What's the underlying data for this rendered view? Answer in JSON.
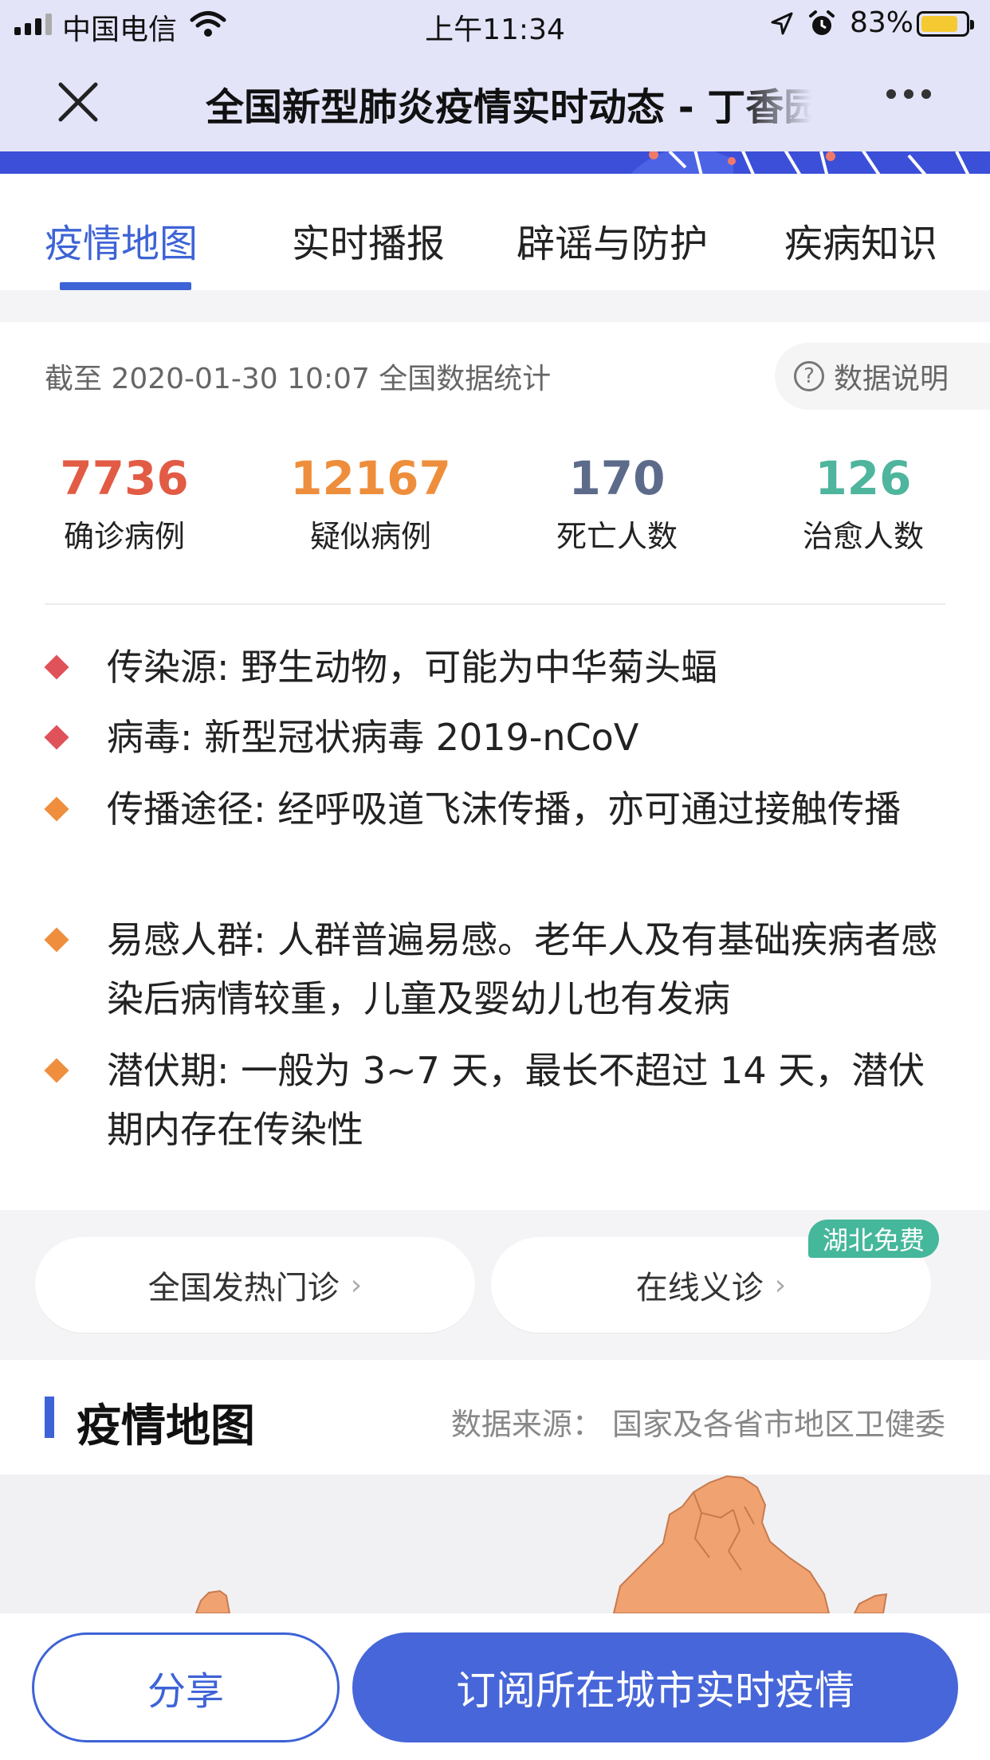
{
  "status_bar": {
    "carrier": "中国电信",
    "time": "上午11:34",
    "battery": "83%",
    "battery_level": 0.83
  },
  "nav": {
    "title": "全国新型肺炎疫情实时动态 - 丁香园",
    "close_icon": "close-icon",
    "more_icon": "more-dots-icon"
  },
  "tabs": [
    {
      "label": "疫情地图",
      "active": true
    },
    {
      "label": "实时播报",
      "active": false
    },
    {
      "label": "辟谣与防护",
      "active": false
    },
    {
      "label": "疾病知识",
      "active": false
    }
  ],
  "summary": {
    "as_of": "截至 2020-01-30 10:07 全国数据统计",
    "explain_label": "数据说明",
    "stats": [
      {
        "value": "7736",
        "label": "确诊病例",
        "color": "#e25b45"
      },
      {
        "value": "12167",
        "label": "疑似病例",
        "color": "#ee8e3c"
      },
      {
        "value": "170",
        "label": "死亡人数",
        "color": "#5d6b8b"
      },
      {
        "value": "126",
        "label": "治愈人数",
        "color": "#4fb59d"
      }
    ]
  },
  "facts": [
    {
      "text": "传染源: 野生动物，可能为中华菊头蝠",
      "color": "#e0525a"
    },
    {
      "text": "病毒: 新型冠状病毒 2019-nCoV",
      "color": "#e0525a"
    },
    {
      "text": "传播途径: 经呼吸道飞沫传播，亦可通过接触传播",
      "color": "#ef8e3d"
    },
    {
      "text": "易感人群: 人群普遍易感。老年人及有基础疾病者感染后病情较重，儿童及婴幼儿也有发病",
      "color": "#ef8e3d"
    },
    {
      "text": "潜伏期: 一般为 3~7 天，最长不超过 14 天，潜伏期内存在传染性",
      "color": "#ef8e3d"
    }
  ],
  "services": {
    "fever_clinic": "全国发热门诊",
    "online_consult": "在线义诊",
    "free_badge": "湖北免费"
  },
  "map_section": {
    "title": "疫情地图",
    "source": "数据来源： 国家及各省市地区卫健委",
    "fill_color": "#f0a271"
  },
  "bottom_bar": {
    "share": "分享",
    "subscribe": "订阅所在城市实时疫情"
  },
  "colors": {
    "accent": "#3e63d6",
    "banner": "#3b4fd8"
  }
}
